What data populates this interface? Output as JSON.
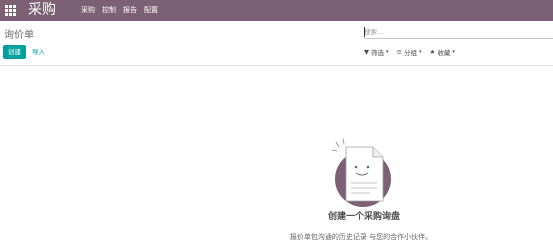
{
  "navbar": {
    "app_title": "采购",
    "menu": [
      "采购",
      "控制",
      "报告",
      "配置"
    ]
  },
  "control_panel": {
    "title": "询价单",
    "search_placeholder": "搜索...",
    "create_label": "创建",
    "import_label": "导入",
    "filters_label": "筛选",
    "group_by_label": "分组",
    "favorites_label": "收藏"
  },
  "help": {
    "title": "创建一个采购询盘",
    "subtitle": "报价单包沟通的历史记录 与您的合作小伙伴。"
  },
  "colors": {
    "navbar": "#7c6175",
    "primary": "#00a09d",
    "illustration_circle": "#7c6175"
  }
}
